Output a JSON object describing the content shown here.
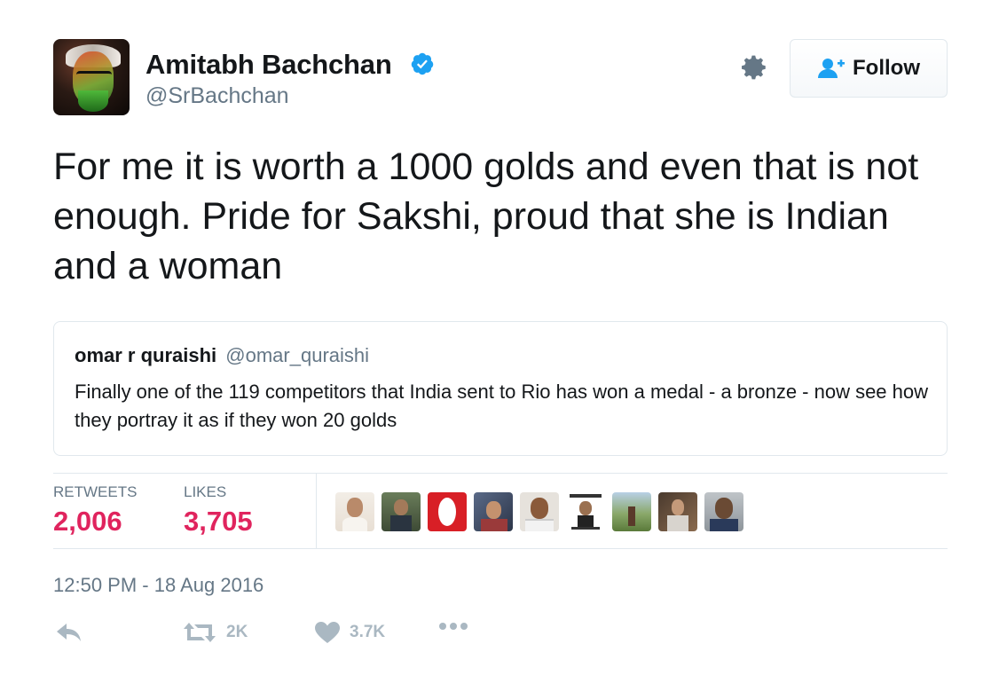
{
  "author": {
    "name": "Amitabh Bachchan",
    "handle": "@SrBachchan",
    "verified": true
  },
  "follow_button": {
    "label": "Follow"
  },
  "tweet": {
    "text": "For me it is worth a 1000 golds and even that is not enough. Pride for Sakshi, proud that she is Indian and a woman"
  },
  "quoted_tweet": {
    "name": "omar r quraishi",
    "handle": "@omar_quraishi",
    "text": "Finally one of the 119 competitors that India sent to Rio has won a medal - a bronze - now see how they portray it as if they won 20 golds"
  },
  "stats": {
    "retweets_label": "RETWEETS",
    "retweets_value": "2,006",
    "likes_label": "LIKES",
    "likes_value": "3,705"
  },
  "timestamp": "12:50 PM - 18 Aug 2016",
  "actions": {
    "retweet_count": "2K",
    "like_count": "3.7K"
  },
  "colors": {
    "accent_like": "#e0245e",
    "verified_blue": "#1da1f2",
    "muted_text": "#657786",
    "icon_gray": "#aab8c2"
  }
}
